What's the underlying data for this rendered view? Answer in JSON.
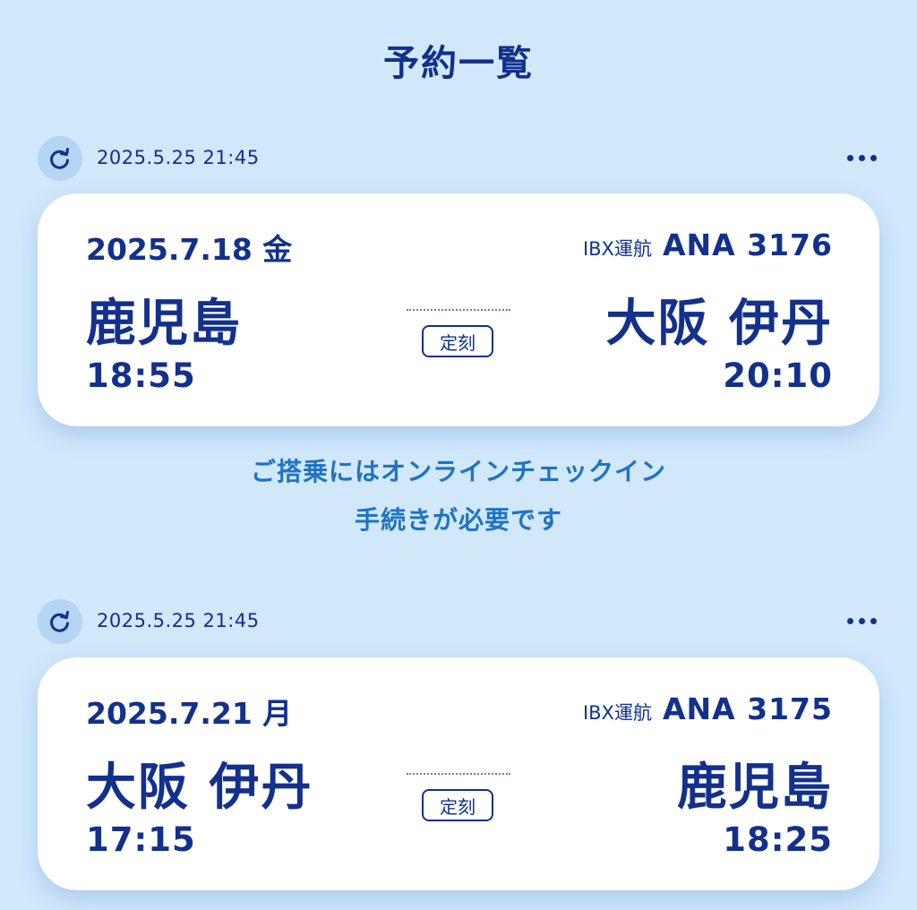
{
  "header": {
    "title": "予約一覧"
  },
  "colors": {
    "background": "#d1e8fb",
    "primary": "#12308c",
    "link": "#1f73c4",
    "card": "#ffffff"
  },
  "reservations": [
    {
      "updated_at": "2025.5.25 21:45",
      "date": "2025.7.18 金",
      "operated_by": "IBX運航",
      "flight_number": "ANA 3176",
      "origin": "鹿児島",
      "destination": "大阪 伊丹",
      "departure_time": "18:55",
      "arrival_time": "20:10",
      "status": "定刻",
      "notice_line1": "ご搭乗にはオンラインチェックイン",
      "notice_line2": "手続きが必要です"
    },
    {
      "updated_at": "2025.5.25 21:45",
      "date": "2025.7.21 月",
      "operated_by": "IBX運航",
      "flight_number": "ANA 3175",
      "origin": "大阪 伊丹",
      "destination": "鹿児島",
      "departure_time": "17:15",
      "arrival_time": "18:25",
      "status": "定刻"
    }
  ],
  "icons": {
    "refresh": "refresh-icon",
    "more": "more-icon"
  }
}
